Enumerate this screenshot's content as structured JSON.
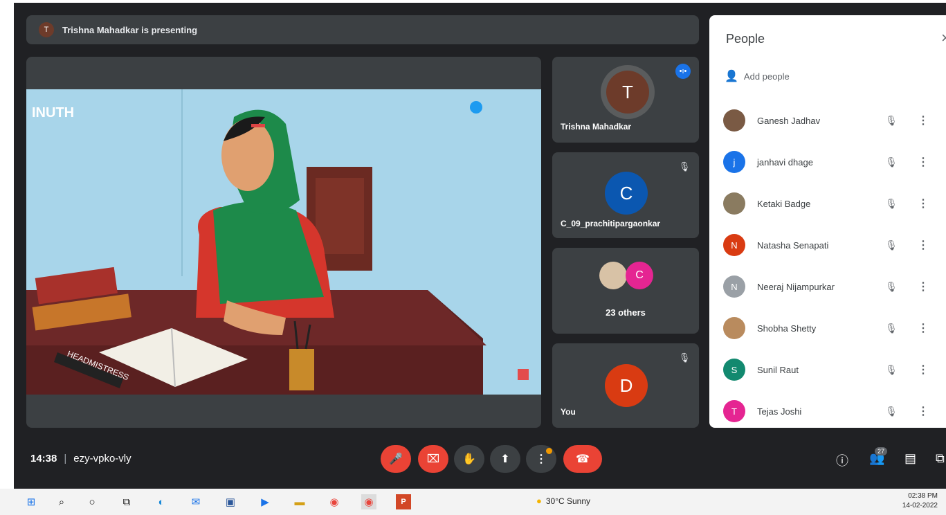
{
  "meeting": {
    "presenting_banner": "Trishna Mahadkar is presenting",
    "presenter_initial": "T",
    "time": "14:38",
    "meeting_code": "ezy-vpko-vly",
    "people_count": "27"
  },
  "slide": {
    "logo_text": "INUTH",
    "book_label": "HEADMISTRESS"
  },
  "tiles": [
    {
      "name": "Trishna Mahadkar",
      "initial": "T",
      "color": "#6d3b2a",
      "speaking": true
    },
    {
      "name": "C_09_prachitipargaonkar",
      "initial": "C",
      "color": "#0b57b0",
      "muted": true
    },
    {
      "label": "23 others",
      "initial": "C",
      "color": "#e52592"
    },
    {
      "name": "You",
      "initial": "D",
      "color": "#d93b12",
      "muted": true
    }
  ],
  "people_panel": {
    "title": "People",
    "add_label": "Add people",
    "people": [
      {
        "name": "Ganesh Jadhav",
        "initial": "",
        "color": "#7a5a44",
        "photo": true
      },
      {
        "name": "janhavi dhage",
        "initial": "j",
        "color": "#1a73e8"
      },
      {
        "name": "Ketaki Badge",
        "initial": "",
        "color": "#8a7b60",
        "photo": true
      },
      {
        "name": "Natasha Senapati",
        "initial": "N",
        "color": "#d93b12"
      },
      {
        "name": "Neeraj Nijampurkar",
        "initial": "N",
        "color": "#9aa0a6"
      },
      {
        "name": "Shobha Shetty",
        "initial": "",
        "color": "#b98b5e",
        "photo": true
      },
      {
        "name": "Sunil Raut",
        "initial": "S",
        "color": "#12896f"
      },
      {
        "name": "Tejas Joshi",
        "initial": "T",
        "color": "#e52592"
      }
    ]
  },
  "taskbar": {
    "weather": "30°C Sunny",
    "time": "02:38 PM",
    "date": "14-02-2022"
  }
}
